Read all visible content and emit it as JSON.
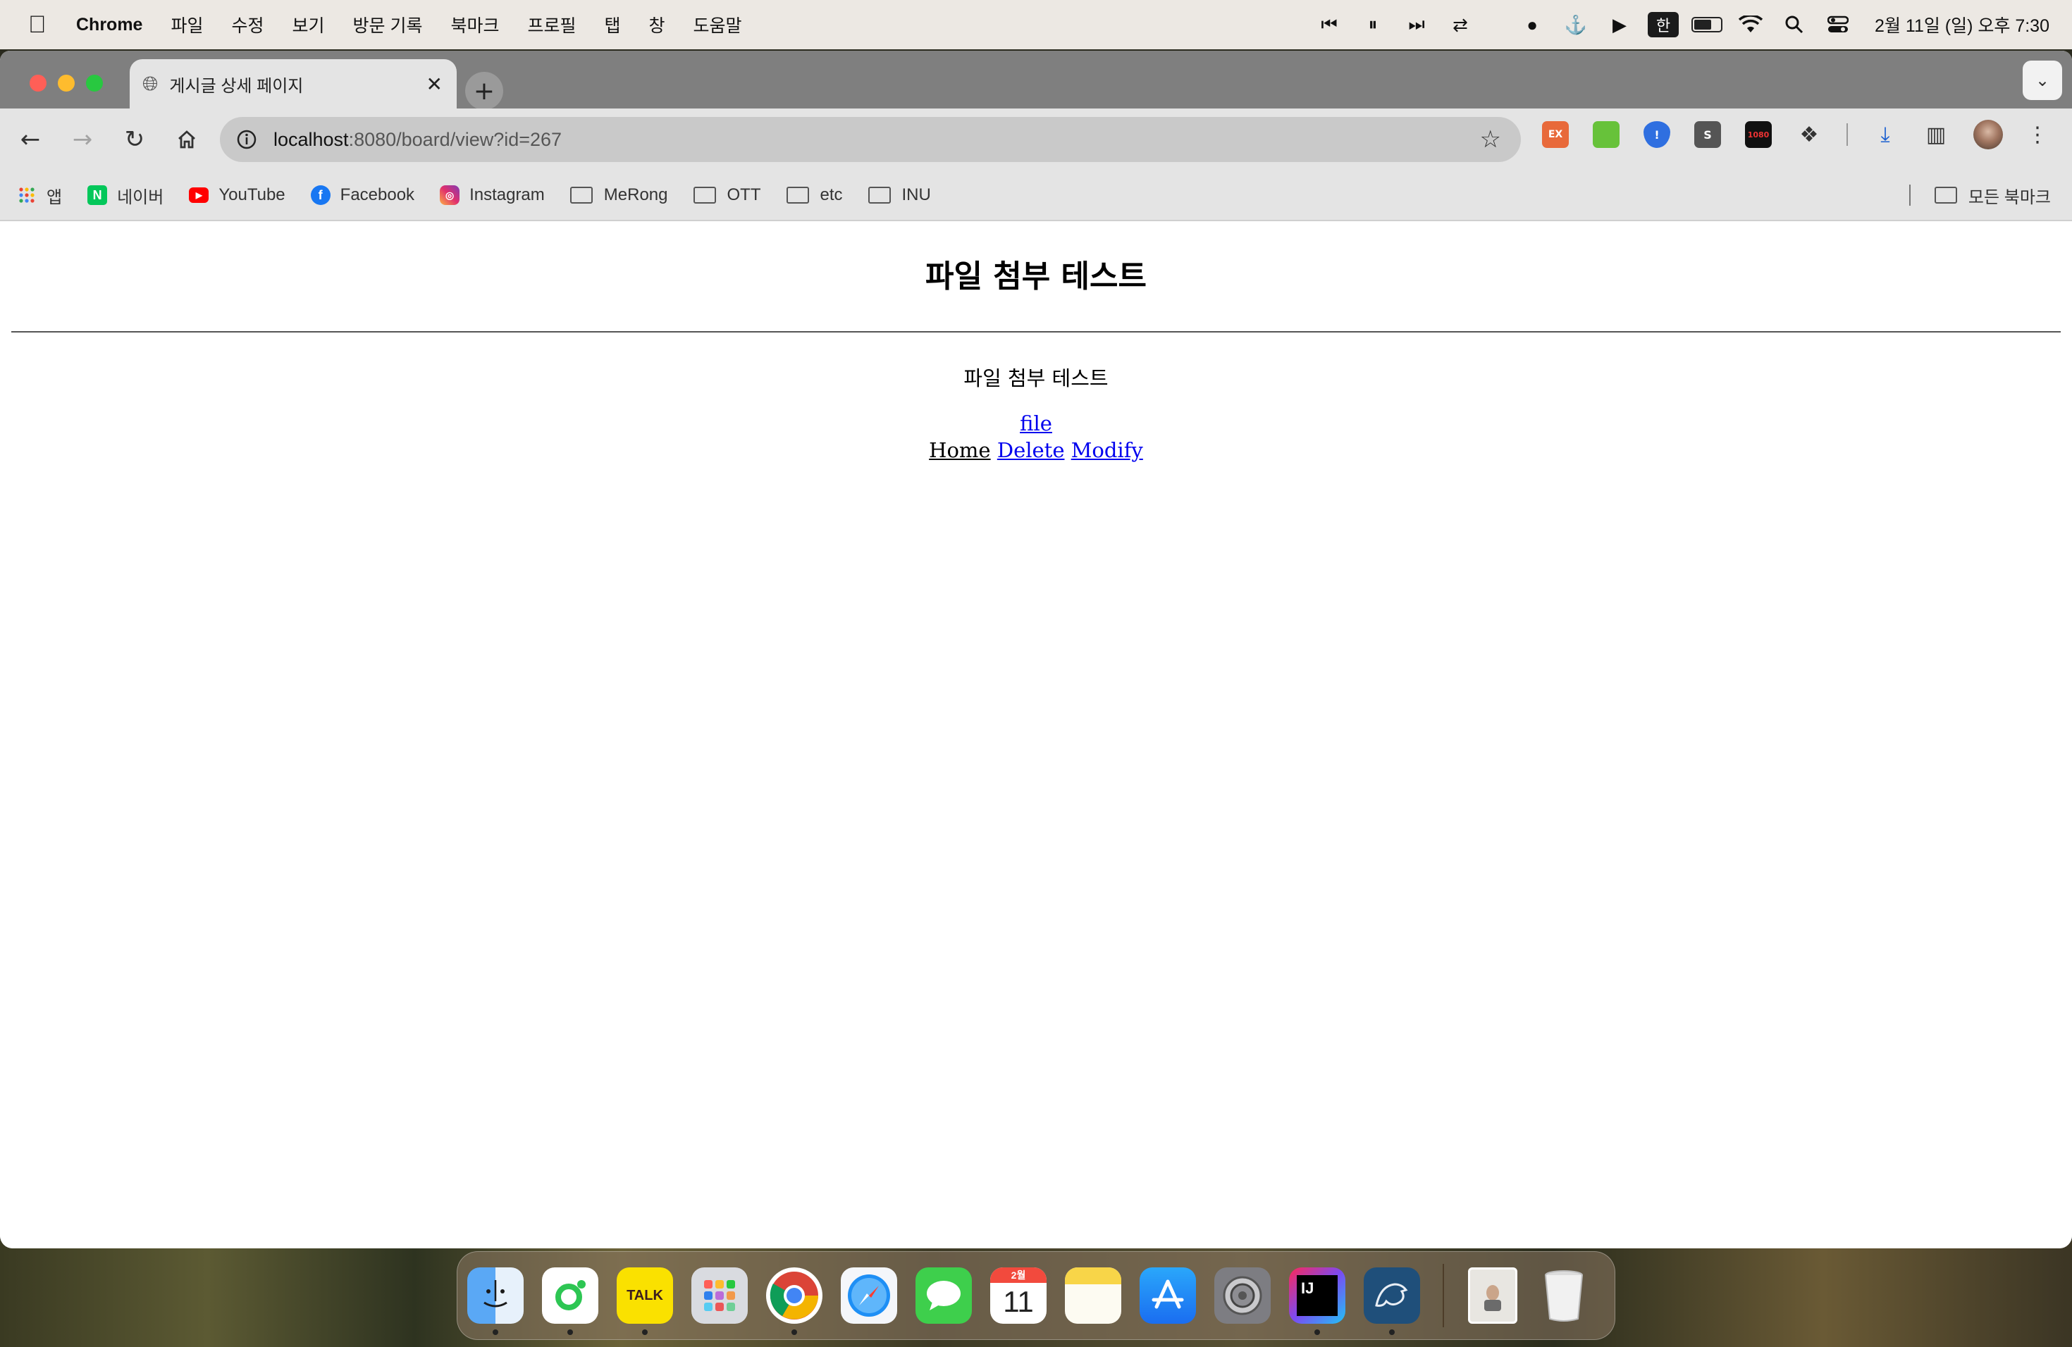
{
  "menubar": {
    "app_name": "Chrome",
    "items": [
      "파일",
      "수정",
      "보기",
      "방문 기록",
      "북마크",
      "프로필",
      "탭",
      "창",
      "도움말"
    ],
    "input_method": "한",
    "clock": "2월 11일 (일) 오후 7:30"
  },
  "tab": {
    "title": "게시글 상세 페이지"
  },
  "address_bar": {
    "host": "localhost",
    "path": ":8080/board/view?id=267"
  },
  "bookmarks": {
    "items": [
      {
        "label": "앱",
        "icon": "apps-grid-icon"
      },
      {
        "label": "네이버",
        "icon": "naver-icon"
      },
      {
        "label": "YouTube",
        "icon": "youtube-icon"
      },
      {
        "label": "Facebook",
        "icon": "facebook-icon"
      },
      {
        "label": "Instagram",
        "icon": "instagram-icon"
      },
      {
        "label": "MeRong",
        "icon": "folder-icon"
      },
      {
        "label": "OTT",
        "icon": "folder-icon"
      },
      {
        "label": "etc",
        "icon": "folder-icon"
      },
      {
        "label": "INU",
        "icon": "folder-icon"
      }
    ],
    "all_bookmarks": "모든 북마크"
  },
  "page": {
    "heading": "파일 첨부 테스트",
    "content": "파일 첨부 테스트",
    "file_link": "file",
    "home_link": "Home",
    "delete_link": "Delete",
    "modify_link": "Modify"
  },
  "extensions": {
    "ex_label": "EX",
    "s_label": "S",
    "hd_label": "1080"
  },
  "dock": {
    "kakao_label": "TALK",
    "calendar_month": "2월",
    "calendar_day": "11",
    "intellij_label": "IJ"
  },
  "colors": {
    "link": "#0000ee",
    "tabstrip": "#7f7f7f",
    "toolbar": "#e4e4e4"
  }
}
